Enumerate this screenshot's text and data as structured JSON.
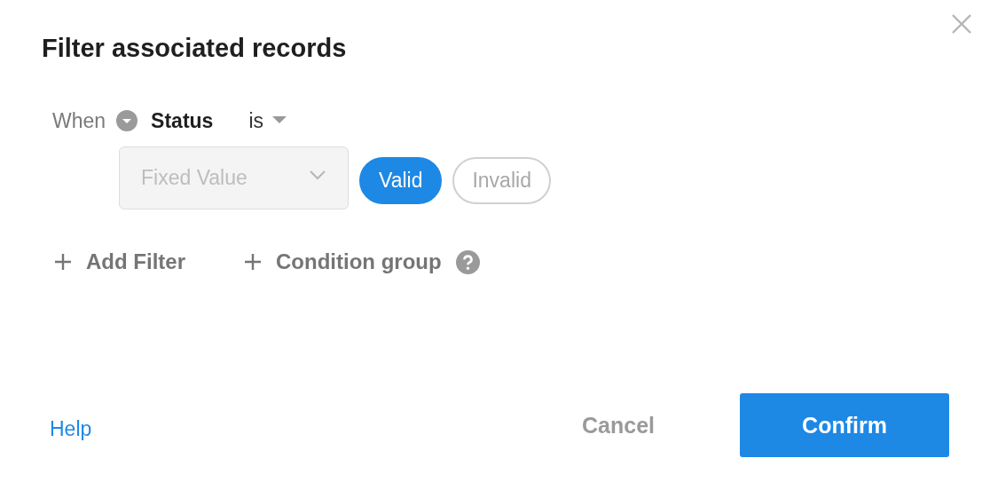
{
  "dialog": {
    "title": "Filter associated records"
  },
  "condition": {
    "prefix": "When",
    "field": "Status",
    "operator": "is",
    "value_source": {
      "placeholder": "Fixed Value",
      "disabled": true
    },
    "options": [
      {
        "label": "Valid",
        "selected": true
      },
      {
        "label": "Invalid",
        "selected": false
      }
    ]
  },
  "actions": [
    {
      "label": "Add Filter",
      "help": false
    },
    {
      "label": "Condition group",
      "help": true
    }
  ],
  "footer": {
    "help_link": "Help",
    "cancel": "Cancel",
    "confirm": "Confirm"
  }
}
